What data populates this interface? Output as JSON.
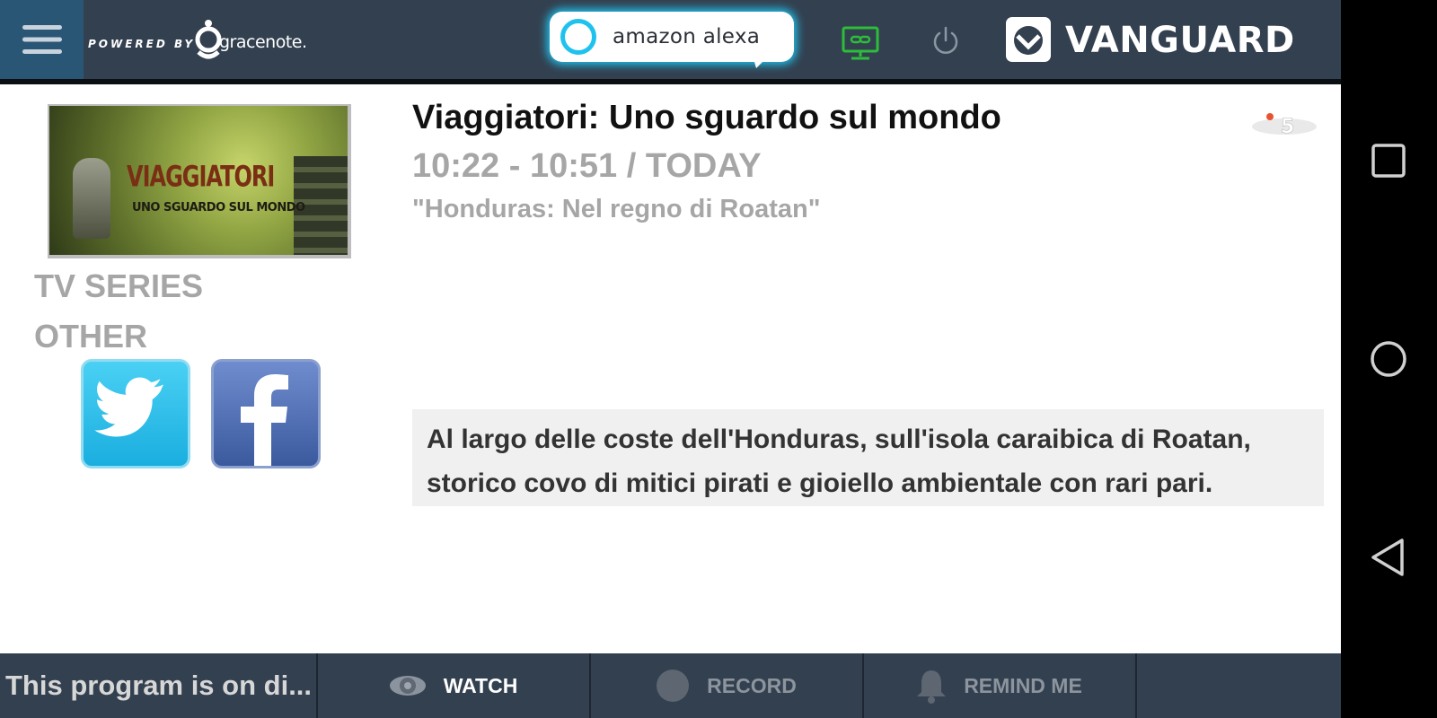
{
  "header": {
    "powered_by": "POWERED BY",
    "gracenote": "gracenote.",
    "alexa_label": "amazon alexa",
    "brand": "VANGUARD"
  },
  "program": {
    "title": "Viaggiatori: Uno sguardo sul mondo",
    "time": "10:22 - 10:51 / TODAY",
    "episode": "\"Honduras: Nel regno di Roatan\"",
    "genre": "TV SERIES",
    "category": "OTHER",
    "description": "Al largo delle coste dell'Honduras, sull'isola caraibica di Roatan, storico covo di mitici pirati e gioiello ambientale con rari pari.",
    "channel_logo_text": "5",
    "thumbnail": {
      "title": "VIAGGIATORI",
      "subtitle": "UNO SGUARDO SUL MONDO"
    }
  },
  "footer": {
    "status": "This program is on di...",
    "watch": "WATCH",
    "record": "RECORD",
    "remind": "REMIND ME"
  },
  "colors": {
    "topbar": "#334050",
    "menu_active": "#2a5676",
    "alexa_blue": "#1fc2ef",
    "monitor_green": "#2dbd3a",
    "label_gray": "#a6a6a6",
    "desc_bg": "#f0f0f0",
    "twitter": "#1aaedf",
    "facebook": "#3b5a9e"
  },
  "icons": {
    "menu": "hamburger-icon",
    "alexa": "alexa-ring-icon",
    "monitor": "monitor-link-icon",
    "power": "power-icon",
    "vanguard": "vanguard-shield-icon",
    "twitter": "twitter-bird-icon",
    "facebook": "facebook-f-icon",
    "watch": "eye-icon",
    "record": "record-dot-icon",
    "remind": "bell-icon",
    "nav_recents": "square-icon",
    "nav_home": "circle-icon",
    "nav_back": "triangle-back-icon"
  }
}
